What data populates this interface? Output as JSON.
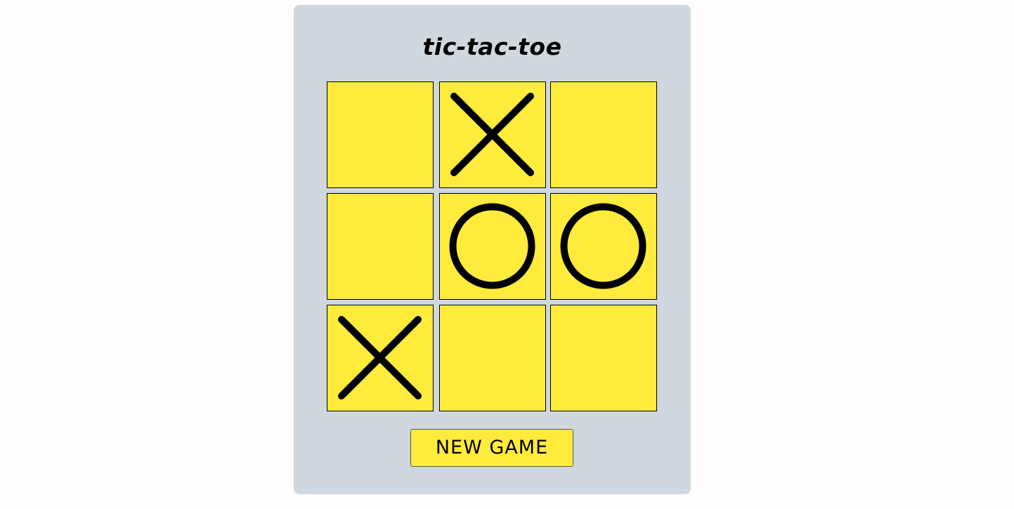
{
  "game": {
    "title": "tic-tac-toe",
    "board": [
      [
        "",
        "X",
        ""
      ],
      [
        "",
        "O",
        "O"
      ],
      [
        "X",
        "",
        ""
      ]
    ],
    "new_game_label": "NEW GAME"
  },
  "colors": {
    "page_background": "#fefefe",
    "panel_background": "#cfd8df",
    "cell_background": "#ffeb3c",
    "mark_color": "#000000",
    "button_background": "#ffeb3c"
  }
}
